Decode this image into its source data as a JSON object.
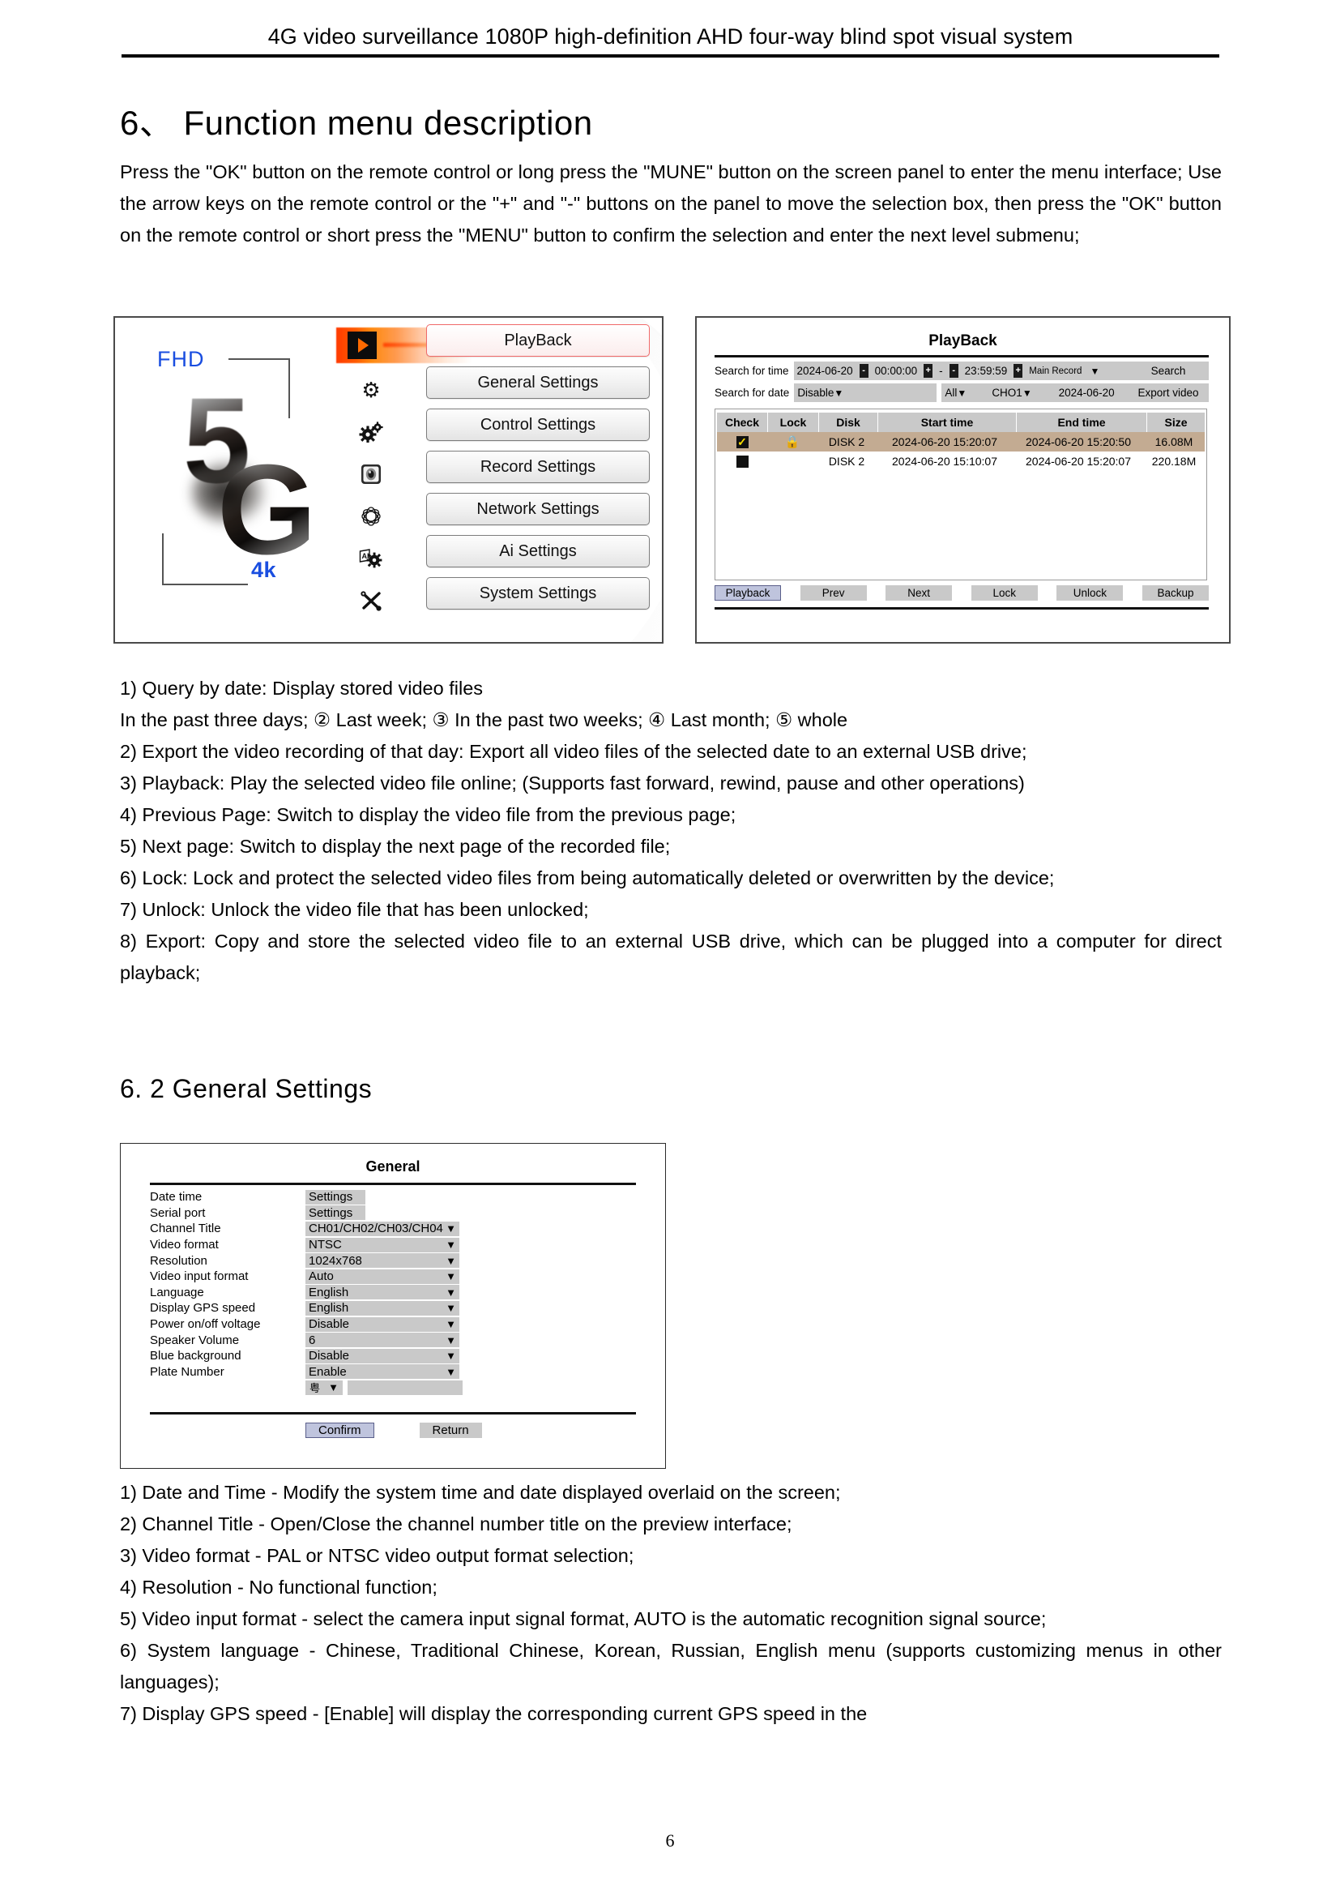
{
  "header": {
    "title": "4G video surveillance 1080P high-definition AHD four-way blind spot visual system"
  },
  "section6": {
    "heading": "6、 Function menu description",
    "paragraph": "Press the \"OK\" button on the remote control or long press the \"MUNE\" button on the screen panel to enter the menu interface; Use the arrow keys on the remote control or the \"+\" and \"-\" buttons on the panel to move the selection box, then press the \"OK\" button on the remote control or short press the \"MENU\" button to confirm the selection and enter the next level submenu;"
  },
  "menu_screen": {
    "logo": {
      "fhd": "FHD",
      "four_k": "4k",
      "digit": "5",
      "letter": "G"
    },
    "items": [
      {
        "label": "PlayBack",
        "icon": "play-icon",
        "selected": true
      },
      {
        "label": "General Settings",
        "icon": "gear-icon",
        "selected": false
      },
      {
        "label": "Control Settings",
        "icon": "double-gear-icon",
        "selected": false
      },
      {
        "label": "Record Settings",
        "icon": "camera-icon",
        "selected": false
      },
      {
        "label": "Network Settings",
        "icon": "globe-network-icon",
        "selected": false
      },
      {
        "label": "Ai Settings",
        "icon": "ai-gear-icon",
        "selected": false
      },
      {
        "label": "System Settings",
        "icon": "tools-icon",
        "selected": false
      }
    ]
  },
  "playback_screen": {
    "title": "PlayBack",
    "search_time": {
      "label": "Search for time",
      "date": "2024-06-20",
      "start_time": "00:00:00",
      "range_sep": "-",
      "end_time": "23:59:59",
      "record_type": "Main Record",
      "minus": "-",
      "plus": "+",
      "search_button": "Search"
    },
    "search_date": {
      "label": "Search for date",
      "range": "Disable",
      "all": "All",
      "channel": "CHO1",
      "date": "2024-06-20",
      "export_button": "Export video"
    },
    "table": {
      "columns": [
        "Check",
        "Lock",
        "Disk",
        "Start time",
        "End time",
        "Size"
      ],
      "rows": [
        {
          "checked": true,
          "locked": true,
          "disk": "DISK 2",
          "start_time": "2024-06-20  15:20:07",
          "end_time": "2024-06-20  15:20:50",
          "size": "16.08M",
          "highlighted": true
        },
        {
          "checked": false,
          "locked": false,
          "disk": "DISK 2",
          "start_time": "2024-06-20  15:10:07",
          "end_time": "2024-06-20  15:20:07",
          "size": "220.18M",
          "highlighted": false
        }
      ]
    },
    "buttons": [
      {
        "label": "Playback",
        "active": true
      },
      {
        "label": "Prev",
        "active": false
      },
      {
        "label": "Next",
        "active": false
      },
      {
        "label": "Lock",
        "active": false
      },
      {
        "label": "Unlock",
        "active": false
      },
      {
        "label": "Backup",
        "active": false
      }
    ]
  },
  "playback_notes": [
    "1) Query by date: Display stored video files",
    "In the past three days; ② Last week; ③ In the past two weeks; ④ Last month; ⑤ whole",
    "2) Export the video recording of that day: Export all video files of the selected date to an external USB drive;",
    "3) Playback: Play the selected video file online; (Supports fast forward, rewind, pause and other operations)",
    "4) Previous Page: Switch to display the video file from the previous page;",
    "5) Next page: Switch to display the next page of the recorded file;",
    "6) Lock: Lock and protect the selected video files from being automatically deleted or overwritten by the device;",
    "7) Unlock: Unlock the video file that has been unlocked;",
    "8) Export: Copy and store the selected video file to an external USB drive, which can be plugged into a computer for direct playback;"
  ],
  "section62": {
    "heading": "6. 2  General Settings"
  },
  "general_dialog": {
    "title": "General",
    "rows": [
      {
        "label": "Date time",
        "value": "Settings",
        "type": "button"
      },
      {
        "label": "Serial port",
        "value": "Settings",
        "type": "button"
      },
      {
        "label": "Channel Title",
        "value": "CH01/CH02/CH03/CH04",
        "type": "dropdown"
      },
      {
        "label": "Video format",
        "value": "NTSC",
        "type": "dropdown"
      },
      {
        "label": "Resolution",
        "value": "1024x768",
        "type": "dropdown"
      },
      {
        "label": "Video input format",
        "value": "Auto",
        "type": "dropdown"
      },
      {
        "label": "Language",
        "value": "English",
        "type": "dropdown"
      },
      {
        "label": "Display GPS speed",
        "value": "English",
        "type": "dropdown"
      },
      {
        "label": "Power on/off voltage",
        "value": "Disable",
        "type": "dropdown"
      },
      {
        "label": "Speaker Volume",
        "value": "6",
        "type": "dropdown"
      },
      {
        "label": "Blue background",
        "value": "Disable",
        "type": "dropdown"
      },
      {
        "label": "Plate Number",
        "value": "Enable",
        "type": "dropdown"
      }
    ],
    "plate_prefix": "粤",
    "plate_input_value": "",
    "confirm_label": "Confirm",
    "return_label": "Return"
  },
  "general_notes": [
    "1) Date and Time - Modify the system time and date displayed overlaid on the screen;",
    "2) Channel Title - Open/Close the channel number title on the preview interface;",
    "3) Video format - PAL or NTSC video output format selection;",
    "4) Resolution - No functional function;",
    "5) Video input format - select the camera input signal format, AUTO is the automatic recognition signal source;",
    "6) System language - Chinese, Traditional Chinese, Korean, Russian, English menu (supports customizing menus in other languages);",
    "7) Display GPS speed - [Enable] will display the corresponding current GPS speed in the"
  ],
  "footer": {
    "page_number": "6"
  },
  "colors": {
    "accent_red": "#ff3a00",
    "logo_blue": "#1a4ee0",
    "field_gray": "#c9c9c9",
    "row_highlight": "#c3ab92",
    "lock_cyan": "#2fe4ef",
    "active_button": "#bfc4dd"
  }
}
